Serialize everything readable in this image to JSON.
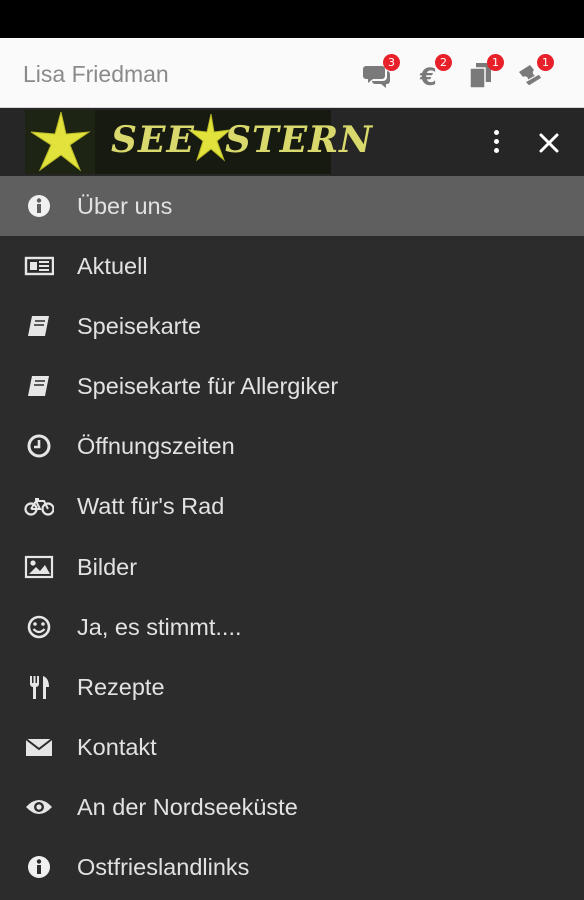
{
  "user": {
    "name": "Lisa Friedman"
  },
  "notifications": [
    {
      "icon": "chat-icon",
      "count": "3"
    },
    {
      "icon": "euro-icon",
      "count": "2"
    },
    {
      "icon": "documents-icon",
      "count": "1"
    },
    {
      "icon": "tickets-icon",
      "count": "1"
    }
  ],
  "brand": {
    "logo_text_left": "SEE",
    "logo_text_right": "STERN",
    "logo_color": "#d8d86c"
  },
  "menu": {
    "items": [
      {
        "label": "Über uns",
        "icon": "info-icon",
        "active": true
      },
      {
        "label": "Aktuell",
        "icon": "newspaper-icon"
      },
      {
        "label": "Speisekarte",
        "icon": "book-icon"
      },
      {
        "label": "Speisekarte für Allergiker",
        "icon": "book-icon"
      },
      {
        "label": "Öffnungszeiten",
        "icon": "clock-icon"
      },
      {
        "label": "Watt für's Rad",
        "icon": "bicycle-icon"
      },
      {
        "label": "Bilder",
        "icon": "picture-icon"
      },
      {
        "label": "Ja, es stimmt....",
        "icon": "smiley-icon"
      },
      {
        "label": "Rezepte",
        "icon": "cutlery-icon"
      },
      {
        "label": "Kontakt",
        "icon": "envelope-icon"
      },
      {
        "label": "An der Nordseeküste",
        "icon": "eye-icon"
      },
      {
        "label": "Ostfrieslandlinks",
        "icon": "info-icon"
      }
    ]
  },
  "colors": {
    "drawer_bg": "#2c2c2c",
    "active_bg": "#5f5f5f",
    "badge": "#e8202a",
    "text": "#e2e2e2"
  }
}
